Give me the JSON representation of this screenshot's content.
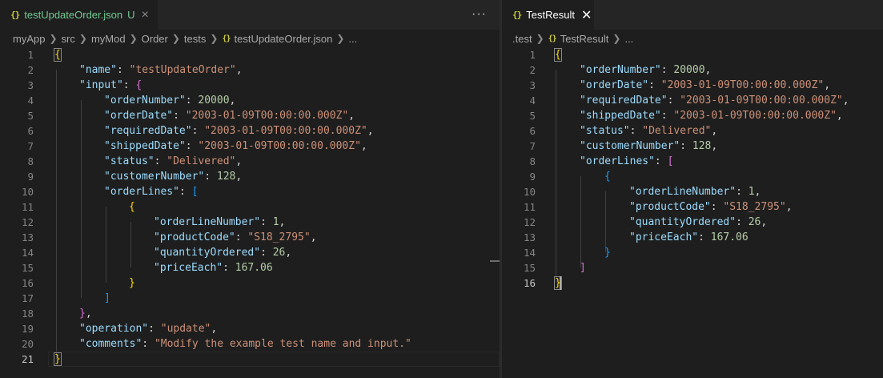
{
  "left": {
    "tab": {
      "icon": "{}",
      "name": "testUpdateOrder.json",
      "status": "U",
      "close": "×"
    },
    "more": "···",
    "breadcrumbs": [
      "myApp",
      "src",
      "myMod",
      "Order",
      "tests",
      "testUpdateOrder.json",
      "..."
    ],
    "line_numbers": [
      "1",
      "2",
      "3",
      "4",
      "5",
      "6",
      "7",
      "8",
      "9",
      "10",
      "11",
      "12",
      "13",
      "14",
      "15",
      "16",
      "17",
      "18",
      "19",
      "20",
      "21"
    ],
    "active_line": "21",
    "code": {
      "name_key": "\"name\"",
      "name_val": "\"testUpdateOrder\"",
      "input_key": "\"input\"",
      "orderNumber_key": "\"orderNumber\"",
      "orderNumber_val": "20000",
      "orderDate_key": "\"orderDate\"",
      "orderDate_val": "\"2003-01-09T00:00:00.000Z\"",
      "requiredDate_key": "\"requiredDate\"",
      "requiredDate_val": "\"2003-01-09T00:00:00.000Z\"",
      "shippedDate_key": "\"shippedDate\"",
      "shippedDate_val": "\"2003-01-09T00:00:00.000Z\"",
      "status_key": "\"status\"",
      "status_val": "\"Delivered\"",
      "customerNumber_key": "\"customerNumber\"",
      "customerNumber_val": "128",
      "orderLines_key": "\"orderLines\"",
      "orderLineNumber_key": "\"orderLineNumber\"",
      "orderLineNumber_val": "1",
      "productCode_key": "\"productCode\"",
      "productCode_val": "\"S18_2795\"",
      "quantityOrdered_key": "\"quantityOrdered\"",
      "quantityOrdered_val": "26",
      "priceEach_key": "\"priceEach\"",
      "priceEach_val": "167.06",
      "operation_key": "\"operation\"",
      "operation_val": "\"update\"",
      "comments_key": "\"comments\"",
      "comments_val": "\"Modify the example test name and input.\""
    }
  },
  "right": {
    "tab": {
      "icon": "{}",
      "name": "TestResult",
      "close": "✕"
    },
    "breadcrumbs": [
      ".test",
      "TestResult",
      "..."
    ],
    "line_numbers": [
      "1",
      "2",
      "3",
      "4",
      "5",
      "6",
      "7",
      "8",
      "9",
      "10",
      "11",
      "12",
      "13",
      "14",
      "15",
      "16"
    ],
    "active_line": "16",
    "code": {
      "orderNumber_key": "\"orderNumber\"",
      "orderNumber_val": "20000",
      "orderDate_key": "\"orderDate\"",
      "orderDate_val": "\"2003-01-09T00:00:00.000Z\"",
      "requiredDate_key": "\"requiredDate\"",
      "requiredDate_val": "\"2003-01-09T00:00:00.000Z\"",
      "shippedDate_key": "\"shippedDate\"",
      "shippedDate_val": "\"2003-01-09T00:00:00.000Z\"",
      "status_key": "\"status\"",
      "status_val": "\"Delivered\"",
      "customerNumber_key": "\"customerNumber\"",
      "customerNumber_val": "128",
      "orderLines_key": "\"orderLines\"",
      "orderLineNumber_key": "\"orderLineNumber\"",
      "orderLineNumber_val": "1",
      "productCode_key": "\"productCode\"",
      "productCode_val": "\"S18_2795\"",
      "quantityOrdered_key": "\"quantityOrdered\"",
      "quantityOrdered_val": "26",
      "priceEach_key": "\"priceEach\"",
      "priceEach_val": "167.06"
    }
  },
  "colors": {
    "background": "#1e1e1e",
    "key": "#9cdcfe",
    "string": "#ce9178",
    "number": "#b5cea8",
    "bracket_level1": "#ffd700",
    "bracket_level2": "#da70d6",
    "bracket_level3": "#179fff",
    "untracked_file": "#73c991"
  }
}
